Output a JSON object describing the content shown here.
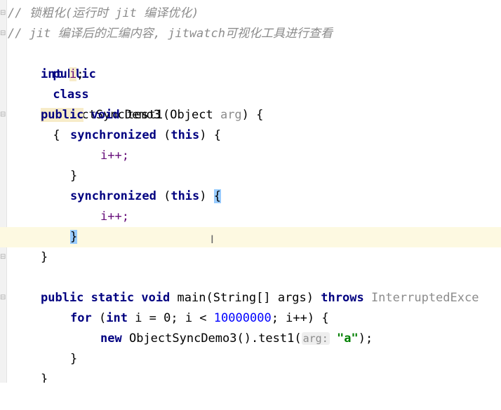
{
  "code": {
    "comment1": "// 锁粗化(运行时 jit 编译优化)",
    "comment2": "// jit 编译后的汇编内容, jitwatch可视化工具进行查看",
    "class_decl": {
      "kw1": "public",
      "kw2": "class",
      "name": "ObjectSyncDemo3",
      "brace": "{"
    },
    "field_decl": {
      "type": "int",
      "name": "i",
      "semi": ";"
    },
    "method1": {
      "kw1": "public",
      "kw2": "void",
      "name": "test1(Object",
      "param": "arg",
      "tail": ") {"
    },
    "sync1": {
      "kw": "synchronized",
      "open": "(",
      "this": "this",
      "close": ") {"
    },
    "inc1": "i++;",
    "close_sync1": "}",
    "sync2": {
      "kw": "synchronized",
      "open": "(",
      "this": "this",
      "close": ")",
      "brace": "{"
    },
    "inc2": "i++;",
    "close_sync2": "}",
    "close_method1": "}",
    "method2": {
      "kw1": "public",
      "kw2": "static",
      "kw3": "void",
      "sig": "main(String[] args)",
      "kw4": "throws",
      "exc": "InterruptedExce"
    },
    "for_loop": {
      "kw": "for",
      "open": "(",
      "type": "int",
      "init": "i = 0; i <",
      "limit": "10000000",
      "tail": "; i++) {"
    },
    "new_stmt": {
      "kw": "new",
      "call": "ObjectSyncDemo3().test1(",
      "hint": "arg:",
      "str": "\"a\"",
      "tail": ");"
    },
    "close_for": "}",
    "close_main": "}"
  },
  "icons": {
    "fold_marker": "fold-marker-icon",
    "cursor": "text-cursor-icon"
  }
}
